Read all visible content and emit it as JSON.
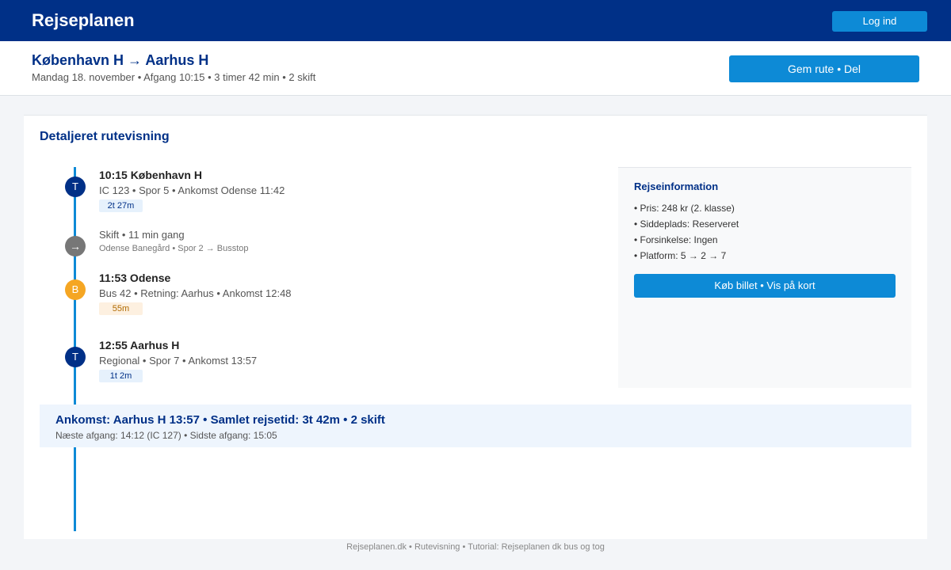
{
  "header": {
    "brand": "Rejseplanen",
    "login_label": "Log ind"
  },
  "route": {
    "title": "København H → Aarhus H",
    "subtitle": "Mandag 18. november • Afgang 10:15 • 3 timer 42 min • 2 skift",
    "save_label": "Gem rute • Del"
  },
  "details": {
    "title": "Detaljeret rutevisning",
    "legs": [
      {
        "icon": "T",
        "title": "10:15 København H",
        "detail": "IC 123 • Spor 5 • Ankomst Odense 11:42",
        "duration": "2t 27m"
      },
      {
        "icon": "→",
        "title": "Skift • 11 min gang",
        "detail": "Odense Banegård • Spor 2 → Busstop"
      },
      {
        "icon": "B",
        "title": "11:53 Odense",
        "detail": "Bus 42 • Retning: Aarhus • Ankomst 12:48",
        "duration": "55m"
      },
      {
        "icon": "T",
        "title": "12:55 Aarhus H",
        "detail": "Regional • Spor 7 • Ankomst 13:57",
        "duration": "1t 2m"
      }
    ]
  },
  "info": {
    "title": "Rejseinformation",
    "items": [
      "• Pris: 248 kr (2. klasse)",
      "• Siddeplads: Reserveret",
      "• Forsinkelse: Ingen",
      "• Platform: 5 → 2 → 7"
    ],
    "button_label": "Køb billet • Vis på kort"
  },
  "arrival": {
    "main": "Ankomst: Aarhus H 13:57 • Samlet rejsetid: 3t 42m • 2 skift",
    "sub": "Næste afgang: 14:12 (IC 127) • Sidste afgang: 15:05"
  },
  "footer": {
    "text": "Rejseplanen.dk • Rutevisning • Tutorial: Rejseplanen dk bus og tog"
  },
  "colors": {
    "brand": "#003087",
    "accent": "#0d8ad6",
    "bus": "#f5a623",
    "walk": "#777777"
  }
}
